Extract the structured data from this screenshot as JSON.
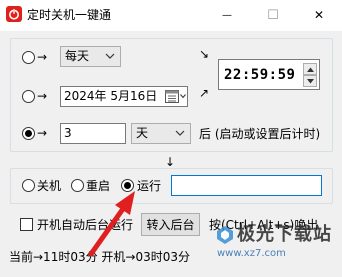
{
  "window": {
    "title": "定时关机一键通",
    "minimize_glyph": "—",
    "maximize_glyph": "☐",
    "close_glyph": "✕"
  },
  "schedule": {
    "daily": {
      "arrow": "→",
      "value": "每天"
    },
    "date": {
      "arrow": "→",
      "value": "2024年 5月16日"
    },
    "countdown": {
      "arrow": "→",
      "value": "3",
      "unit": "天",
      "suffix": "后 (启动或设置后计时)"
    },
    "time_value": "22:59:59",
    "diag_arrow_down": "↘",
    "diag_arrow_up": "↗",
    "down_arrow": "↓",
    "selected": "countdown"
  },
  "action": {
    "options": [
      "关机",
      "重启",
      "运行"
    ],
    "selected": "运行",
    "run_target_value": ""
  },
  "options": {
    "autostart_label": "开机自动后台运行",
    "autostart_checked": false,
    "background_button": "转入后台",
    "hotkey_hint": "按(Ctrl+Alt+s)唤出"
  },
  "status": {
    "text": "当前→11时03分 开机→03时03分"
  },
  "watermark": {
    "name": "极光下载站",
    "url": "www.xz7.com"
  },
  "colors": {
    "app_icon": "#e0201b",
    "annotation_arrow": "#e02020",
    "group_border": "#d5dfe5",
    "client_bg": "#f0f0f0"
  },
  "icons": {
    "app": "power-icon",
    "calendar": "calendar-icon",
    "dropdown": "chevron-down-icon",
    "spinner_up": "caret-up-icon",
    "spinner_down": "caret-down-icon"
  }
}
